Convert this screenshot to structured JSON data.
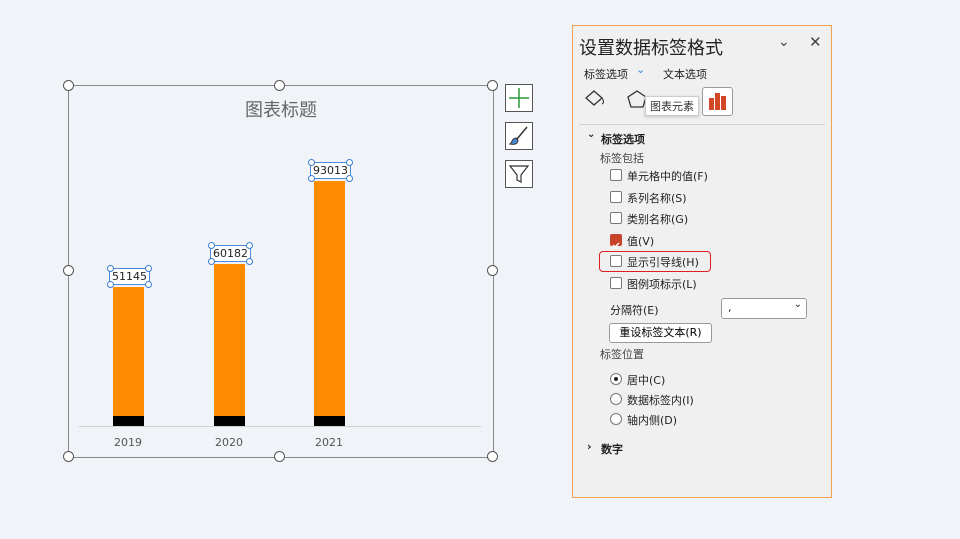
{
  "chart": {
    "title": "图表标题"
  },
  "chart_data": {
    "type": "bar",
    "stacked": true,
    "title": "图表标题",
    "categories": [
      "2019",
      "2020",
      "2021"
    ],
    "series": [
      {
        "values": [
          3800,
          3800,
          3800
        ],
        "color": "#000000"
      },
      {
        "values": [
          51145,
          60182,
          93013
        ],
        "color": "#ff8c00"
      }
    ],
    "data_labels": [
      "51145",
      "60182",
      "93013"
    ],
    "ylim": [
      0,
      100000
    ],
    "grid": false
  },
  "side_buttons": [
    "chart-elements",
    "chart-styles",
    "chart-filters"
  ],
  "pane": {
    "title": "设置数据标签格式",
    "tabs": [
      "标签选项",
      "文本选项"
    ],
    "tooltip": "图表元素",
    "section": "标签选项",
    "include_heading": "标签包括",
    "checkboxes": [
      {
        "label": "单元格中的值(F)",
        "checked": false
      },
      {
        "label": "系列名称(S)",
        "checked": false
      },
      {
        "label": "类别名称(G)",
        "checked": false
      },
      {
        "label": "值(V)",
        "checked": true
      },
      {
        "label": "显示引导线(H)",
        "checked": false,
        "highlighted": true
      },
      {
        "label": "图例项标示(L)",
        "checked": false
      }
    ],
    "separator_label": "分隔符(E)",
    "separator_value": ",",
    "reset_button": "重设标签文本(R)",
    "position_heading": "标签位置",
    "radios": [
      {
        "label": "居中(C)",
        "selected": true
      },
      {
        "label": "数据标签内(I)",
        "selected": false
      },
      {
        "label": "轴内侧(D)",
        "selected": false
      }
    ],
    "number_section": "数字",
    "accent": "#c8432a"
  }
}
